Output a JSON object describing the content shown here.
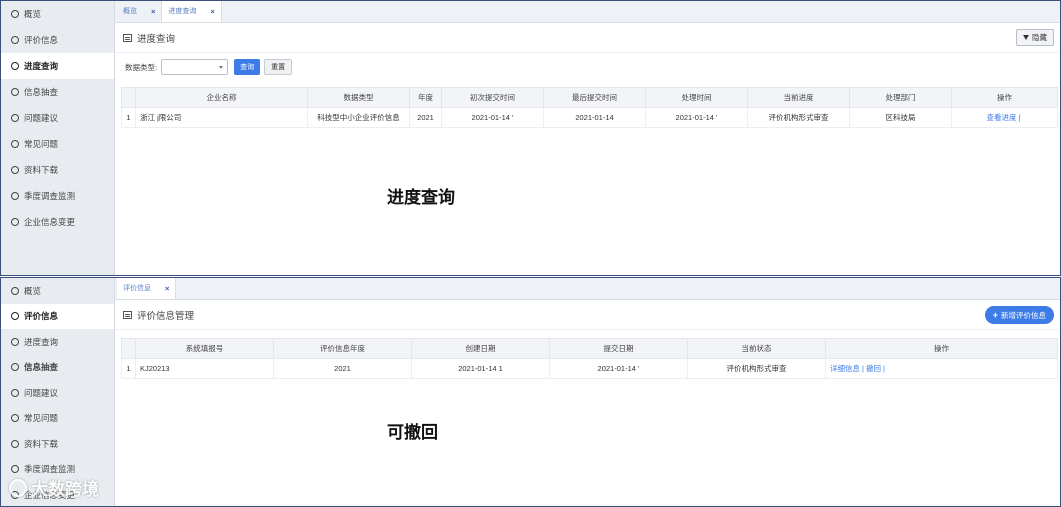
{
  "sidebar_items": [
    "概览",
    "评价信息",
    "进度查询",
    "信息抽查",
    "问题建议",
    "常见问题",
    "资料下载",
    "季度调查监测",
    "企业信息变更"
  ],
  "top": {
    "tabs": [
      {
        "label": "概览",
        "close": "×"
      },
      {
        "label": "进度查询",
        "close": "×"
      }
    ],
    "page_title": "进度查询",
    "hide_button": "隐藏",
    "filter_label": "数据类型:",
    "query_button": "查询",
    "reset_button": "重置",
    "columns": [
      "",
      "企业名称",
      "数据类型",
      "年度",
      "初次提交时间",
      "最后提交时间",
      "处理时间",
      "当前进度",
      "处理部门",
      "操作"
    ],
    "row": {
      "index": "1",
      "company": "浙江          j限公司",
      "data_type": "科技型中小企业评价信息",
      "year": "2021",
      "first_submit": "2021-01-14 '",
      "last_submit": "2021-01-14",
      "process_time": "2021-01-14 '",
      "progress": "评价机构形式审查",
      "department": "区科技局",
      "action": "查看进度",
      "action_sep": "|"
    },
    "caption": "进度查询"
  },
  "bottom": {
    "tabs": [
      {
        "label": "评价信息",
        "close": "×"
      }
    ],
    "page_title": "评价信息管理",
    "add_button": "新增评价信息",
    "columns": [
      "",
      "系统填报号",
      "评价信息年度",
      "创建日期",
      "提交日期",
      "当前状态",
      "操作"
    ],
    "row": {
      "index": "1",
      "report_no": "KJ20213",
      "year": "2021",
      "created": "2021-01-14 1",
      "submitted": "2021-01-14 '",
      "status": "评价机构形式审查",
      "action_detail": "详细信息",
      "action_sep": "|",
      "action_withdraw": "撤回",
      "action_sep2": "|"
    },
    "caption": "可撤回"
  },
  "watermark": "大数跨境",
  "colors": {
    "accent": "#3d7be6",
    "sidebar_bg": "#e8ecf1",
    "border": "#3a4f7a"
  }
}
